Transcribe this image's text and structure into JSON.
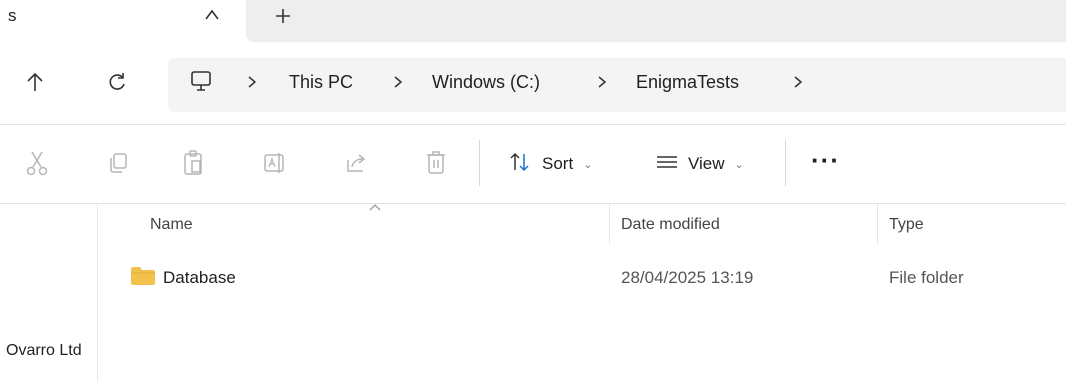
{
  "tab": {
    "title_fragment": "s"
  },
  "breadcrumb": [
    "This PC",
    "Windows (C:)",
    "EnigmaTests"
  ],
  "toolbar": {
    "sort_label": "Sort",
    "view_label": "View"
  },
  "columns": {
    "name": "Name",
    "date_modified": "Date modified",
    "type": "Type"
  },
  "files": [
    {
      "name": "Database",
      "date_modified": "28/04/2025 13:19",
      "type": "File folder",
      "icon": "folder-icon"
    }
  ],
  "navigation_pane": {
    "items": [
      "Ovarro Ltd"
    ]
  },
  "icons": [
    "close-tab-icon",
    "new-tab-icon",
    "up-arrow-icon",
    "refresh-icon",
    "this-pc-icon",
    "cut-icon",
    "copy-icon",
    "paste-icon",
    "rename-icon",
    "share-icon",
    "delete-icon",
    "sort-icon",
    "view-icon",
    "more-icon",
    "folder-icon"
  ],
  "colors": {
    "folder": "#f2c14e",
    "address_bar_bg": "#f4f4f4",
    "tab_strip_bg": "#eeeeee",
    "disabled_icon": "#b5b5b5"
  }
}
